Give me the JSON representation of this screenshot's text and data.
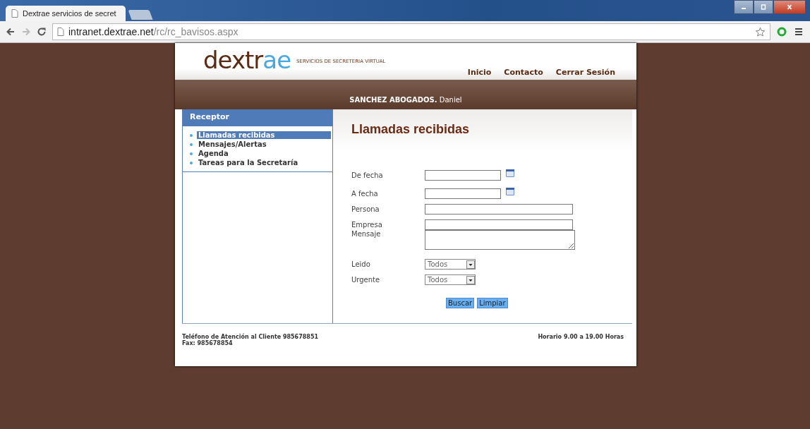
{
  "browser": {
    "tab_title": "Dextrae servicios de secret",
    "url_host": "intranet.dextrae.net",
    "url_path": "/rc/rc_bavisos.aspx"
  },
  "header": {
    "logo_main": "dextr",
    "logo_accent": "ae",
    "tagline": "SERVICIOS DE SECRETERIA VIRTUAL",
    "nav": [
      "Inicio",
      "Contacto",
      "Cerrar Sesión"
    ]
  },
  "user_bar": "**SANCHEZ ABOGADOS.** Daniel",
  "sidebar": {
    "title": "Receptor",
    "items": [
      {
        "label": "Llamadas recibidas",
        "selected": true
      },
      {
        "label": "Mensajes/Alertas",
        "selected": false
      },
      {
        "label": "Agenda",
        "selected": false
      },
      {
        "label": "Tareas para la Secretaría",
        "selected": false
      }
    ]
  },
  "content": {
    "title": "Llamadas recibidas",
    "fields": [
      {
        "kind": "date",
        "label": "De fecha"
      },
      {
        "kind": "date",
        "label": "A fecha"
      },
      {
        "kind": "text",
        "label": "Persona"
      },
      {
        "kind": "text",
        "label": "Empresa"
      },
      {
        "kind": "textarea",
        "label": "Mensaje"
      },
      {
        "kind": "select",
        "label": "Leido",
        "value": "Todos"
      },
      {
        "kind": "select",
        "label": "Urgente",
        "value": "Todos"
      }
    ],
    "buttons": [
      "Buscar",
      "Limpiar"
    ]
  },
  "footer": {
    "phone": "Teléfono de Atención al Cliente 985678851",
    "fax": "Fax: 985678854",
    "hours": "Horario 9.00 a 19.00 Horas"
  }
}
